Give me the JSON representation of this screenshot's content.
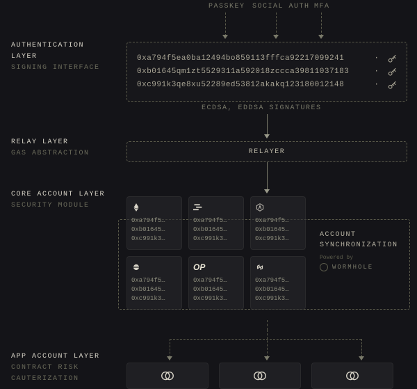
{
  "top": {
    "passkey": "PASSKEY",
    "social": "SOCIAL AUTH",
    "mfa": "MFA"
  },
  "auth": {
    "title": "AUTHENTICATION",
    "title2": "LAYER",
    "sub": "SIGNING INTERFACE",
    "rows": [
      "0xa794f5ea0ba12494bo859113fffca92217099241",
      "0xb01645qm1zt5529311a592018zccca39811037183",
      "0xc991k3qe8xu52289ed53812akakq123180012148"
    ]
  },
  "sig_label": "ECDSA, EDDSA SIGNATURES",
  "relay": {
    "title": "RELAY LAYER",
    "sub": "GAS ABSTRACTION",
    "label": "RELAYER"
  },
  "core": {
    "title": "CORE ACCOUNT LAYER",
    "sub": "SECURITY MODULE",
    "addrs": [
      "0xa794f5…",
      "0xb01645…",
      "0xc991k3…"
    ],
    "chains": [
      "ethereum",
      "solana",
      "arbitrum",
      "generic",
      "optimism",
      "polygon"
    ]
  },
  "sync": {
    "line1": "ACCOUNT",
    "line2": "SYNCHRONIZATION",
    "powered": "Powered by",
    "wormhole": "WORMHOLE"
  },
  "app": {
    "title": "APP ACCOUNT LAYER",
    "sub1": "CONTRACT RISK",
    "sub2": "CAUTERIZATION"
  }
}
